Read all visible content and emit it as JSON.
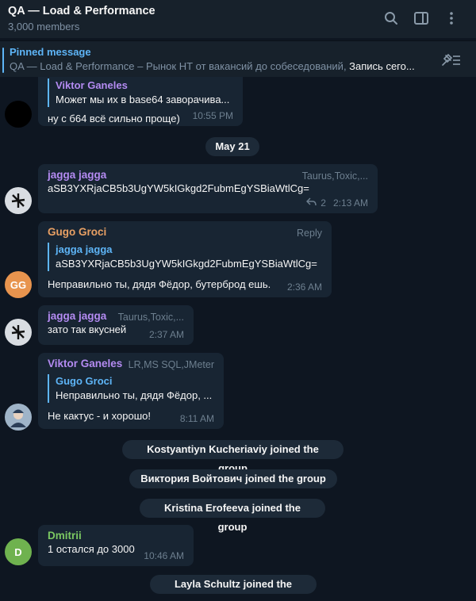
{
  "header": {
    "title": "QA — Load & Performance",
    "members": "3,000 members"
  },
  "pinned": {
    "label": "Pinned message",
    "text_muted": "QA — Load & Performance – Рынок НТ от вакансий до собеседований, ",
    "text_bright": "Запись сего..."
  },
  "messages": {
    "m0": {
      "quote_name": "Viktor Ganeles",
      "quote_text": "Может мы их в base64 заворачива...",
      "text": "ну с б64 всё сильно проще)",
      "time": "10:55 PM"
    },
    "date_pill": "May 21",
    "m1": {
      "sender": "jagga jagga",
      "tag": "Taurus,Toxic,...",
      "text": "aSB3YXRjaCB5b3UgYW5kIGkgd2FubmEgYSBiaWtlCg=",
      "replies": "2",
      "time": "2:13 AM"
    },
    "m2": {
      "sender": "Gugo Groci",
      "reply_label": "Reply",
      "quote_name": "jagga jagga",
      "quote_text": "aSB3YXRjaCB5b3UgYW5kIGkgd2FubmEgYSBiaWtlCg=",
      "text": "Неправильно ты, дядя Фёдор, бутерброд ешь.",
      "time": "2:36 AM",
      "avatar_initials": "GG"
    },
    "m3": {
      "sender": "jagga jagga",
      "tag": "Taurus,Toxic,...",
      "text": "зато так вкусней",
      "time": "2:37 AM"
    },
    "m4": {
      "sender": "Viktor Ganeles",
      "tag": "LR,MS SQL,JMeter",
      "quote_name": "Gugo Groci",
      "quote_text": "Неправильно ты, дядя Фёдор, ...",
      "text": "Не кактус - и хорошо!",
      "time": "8:11 AM"
    },
    "join1": "Kostyantiyn Kucheriaviy joined the group",
    "join2": "Виктория Войтович joined the group",
    "join3": "Kristina Erofeeva joined the group",
    "m5": {
      "sender": "Dmitrii",
      "text": "1 остался до 3000",
      "time": "10:46 AM",
      "avatar_initials": "D"
    },
    "join4": "Layla Schultz joined the group"
  },
  "colors": {
    "background": "#0e1621",
    "bubble": "#182533",
    "accent": "#5eb5f7",
    "jagga_name": "#b48bf2",
    "gugo_name": "#e8a064",
    "viktor_name": "#b48bf2",
    "dmitrii_name": "#7bc862"
  },
  "icons": [
    "search-icon",
    "sidebar-toggle-icon",
    "more-vertical-icon",
    "unpin-list-icon",
    "reply-arrow-icon"
  ]
}
